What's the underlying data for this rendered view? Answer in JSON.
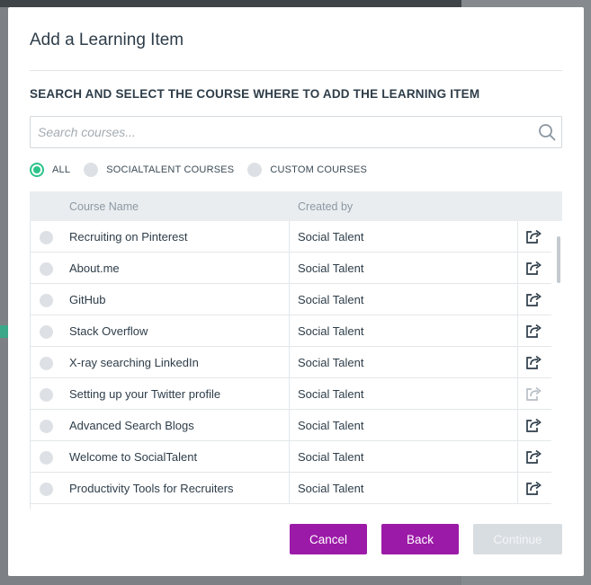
{
  "modal": {
    "title": "Add a Learning Item",
    "section_label": "SEARCH AND SELECT THE COURSE WHERE TO ADD THE LEARNING ITEM"
  },
  "search": {
    "placeholder": "Search courses...",
    "value": "",
    "icon": "search-icon"
  },
  "filters": [
    {
      "label": "ALL",
      "selected": true
    },
    {
      "label": "SOCIALTALENT COURSES",
      "selected": false
    },
    {
      "label": "CUSTOM COURSES",
      "selected": false
    }
  ],
  "table": {
    "columns": [
      "Course Name",
      "Created by"
    ],
    "rows": [
      {
        "name": "Recruiting on Pinterest",
        "created_by": "Social Talent",
        "action_enabled": true
      },
      {
        "name": "About.me",
        "created_by": "Social Talent",
        "action_enabled": true
      },
      {
        "name": "GitHub",
        "created_by": "Social Talent",
        "action_enabled": true
      },
      {
        "name": "Stack Overflow",
        "created_by": "Social Talent",
        "action_enabled": true
      },
      {
        "name": "X-ray searching LinkedIn",
        "created_by": "Social Talent",
        "action_enabled": true
      },
      {
        "name": "Setting up your Twitter profile",
        "created_by": "Social Talent",
        "action_enabled": false
      },
      {
        "name": "Advanced Search Blogs",
        "created_by": "Social Talent",
        "action_enabled": true
      },
      {
        "name": "Welcome to SocialTalent",
        "created_by": "Social Talent",
        "action_enabled": true
      },
      {
        "name": "Productivity Tools for Recruiters",
        "created_by": "Social Talent",
        "action_enabled": true
      }
    ]
  },
  "buttons": {
    "cancel": "Cancel",
    "back": "Back",
    "continue": "Continue"
  },
  "colors": {
    "accent": "#9c1aa8",
    "radio_selected": "#2bc48a",
    "disabled_button": "#d8dde1"
  }
}
